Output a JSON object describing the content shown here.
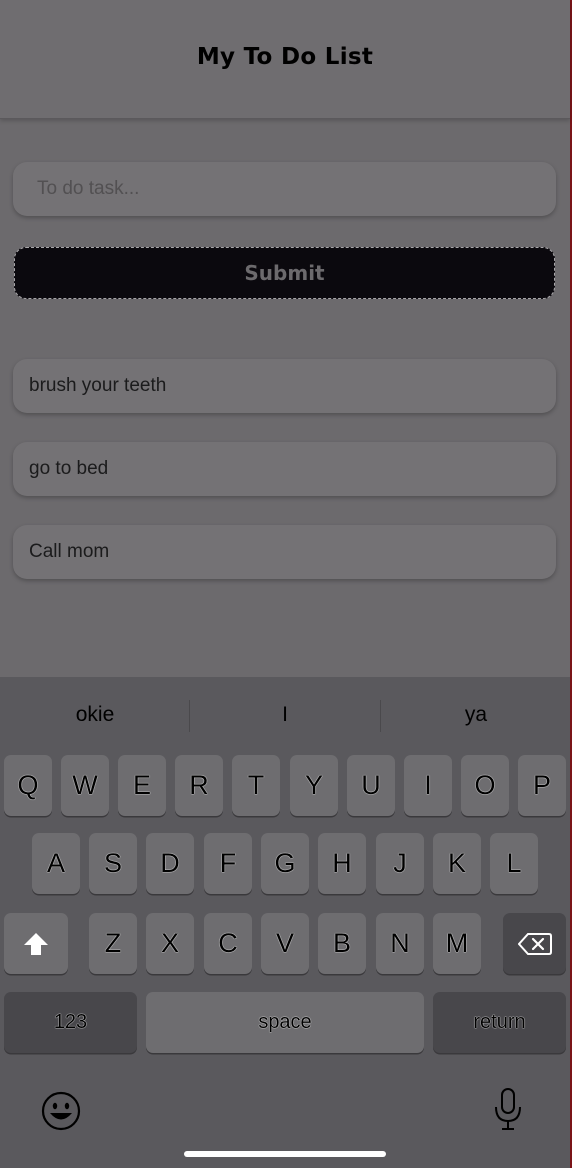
{
  "header": {
    "title": "My To Do List"
  },
  "form": {
    "input_value": "",
    "input_placeholder": "To do task...",
    "submit_label": "Submit"
  },
  "tasks": [
    "brush your teeth",
    "go to bed",
    "Call mom"
  ],
  "keyboard": {
    "suggestions": [
      "okie",
      "I",
      "ya"
    ],
    "row1": [
      "Q",
      "W",
      "E",
      "R",
      "T",
      "Y",
      "U",
      "I",
      "O",
      "P"
    ],
    "row2": [
      "A",
      "S",
      "D",
      "F",
      "G",
      "H",
      "J",
      "K",
      "L"
    ],
    "row3": [
      "Z",
      "X",
      "C",
      "V",
      "B",
      "N",
      "M"
    ],
    "numbers_label": "123",
    "space_label": "space",
    "return_label": "return",
    "icons": {
      "shift": "shift-arrow-icon",
      "delete": "backspace-icon",
      "emoji": "emoji-icon",
      "mic": "microphone-icon"
    }
  },
  "colors": {
    "background": "#6c6a6d",
    "submit_bg": "#0b090e",
    "keyboard_bg": "#5a595d",
    "key_bg": "#6e6d70",
    "key_dark_bg": "#48474b"
  }
}
